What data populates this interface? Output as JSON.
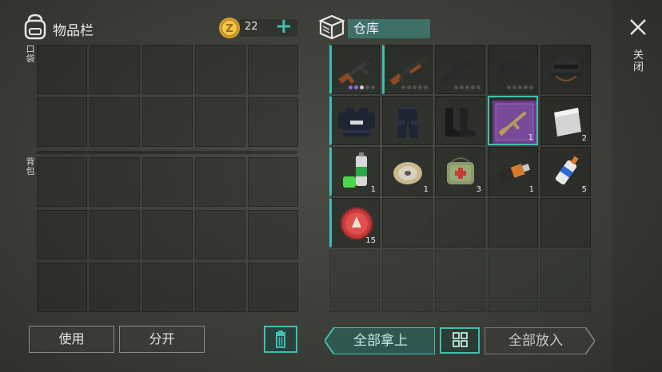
{
  "inventory": {
    "title": "物品栏",
    "coins": "22",
    "pocket_label": "口袋",
    "backpack_label": "背包"
  },
  "buttons": {
    "use": "使用",
    "split": "分开",
    "take_all": "全部拿上",
    "put_all": "全部放入"
  },
  "warehouse": {
    "title": "仓库",
    "items": [
      {
        "name": "ak-rifle",
        "qty": "",
        "dots": [
          "#8c6fd0",
          "#8c6fd0",
          "#cfcfcf",
          "#52544e",
          "#52544e"
        ]
      },
      {
        "name": "pump-shotgun",
        "qty": "",
        "dots": [
          "#52544e",
          "#52544e",
          "#52544e",
          "#52544e",
          "#52544e"
        ]
      },
      {
        "name": "assault-rifle",
        "qty": "",
        "dots": [
          "#52544e",
          "#52544e",
          "#52544e",
          "#52544e",
          "#52544e"
        ]
      },
      {
        "name": "pistol",
        "qty": "",
        "dots": [
          "#52544e",
          "#52544e",
          "#52544e",
          "#52544e",
          "#52544e"
        ]
      },
      {
        "name": "combat-helmet",
        "qty": ""
      },
      {
        "name": "police-vest",
        "qty": ""
      },
      {
        "name": "police-pants",
        "qty": ""
      },
      {
        "name": "combat-boots",
        "qty": ""
      },
      {
        "name": "rifle-blueprint",
        "qty": "1"
      },
      {
        "name": "metal-sheet",
        "qty": "2"
      },
      {
        "name": "spray-can",
        "qty": "1"
      },
      {
        "name": "wire-spool",
        "qty": "1"
      },
      {
        "name": "first-aid-bag",
        "qty": "3"
      },
      {
        "name": "usb-drive",
        "qty": "1"
      },
      {
        "name": "glue-tube",
        "qty": "5"
      },
      {
        "name": "bottle-cap",
        "qty": "15"
      }
    ]
  },
  "close": {
    "label": "关闭"
  },
  "colors": {
    "accent": "#3fbfb0",
    "rare": "#8c6fd0"
  }
}
